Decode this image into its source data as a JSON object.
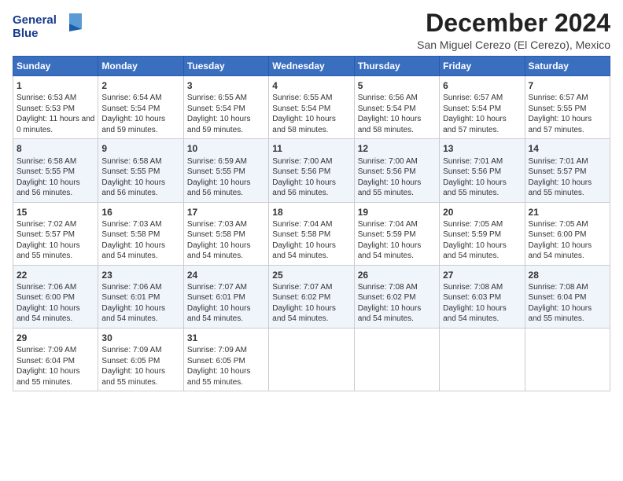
{
  "logo": {
    "line1": "General",
    "line2": "Blue"
  },
  "title": "December 2024",
  "subtitle": "San Miguel Cerezo (El Cerezo), Mexico",
  "days_header": [
    "Sunday",
    "Monday",
    "Tuesday",
    "Wednesday",
    "Thursday",
    "Friday",
    "Saturday"
  ],
  "weeks": [
    [
      {
        "day": "1",
        "sunrise": "6:53 AM",
        "sunset": "5:53 PM",
        "daylight": "11 hours and 0 minutes."
      },
      {
        "day": "2",
        "sunrise": "6:54 AM",
        "sunset": "5:54 PM",
        "daylight": "10 hours and 59 minutes."
      },
      {
        "day": "3",
        "sunrise": "6:55 AM",
        "sunset": "5:54 PM",
        "daylight": "10 hours and 59 minutes."
      },
      {
        "day": "4",
        "sunrise": "6:55 AM",
        "sunset": "5:54 PM",
        "daylight": "10 hours and 58 minutes."
      },
      {
        "day": "5",
        "sunrise": "6:56 AM",
        "sunset": "5:54 PM",
        "daylight": "10 hours and 58 minutes."
      },
      {
        "day": "6",
        "sunrise": "6:57 AM",
        "sunset": "5:54 PM",
        "daylight": "10 hours and 57 minutes."
      },
      {
        "day": "7",
        "sunrise": "6:57 AM",
        "sunset": "5:55 PM",
        "daylight": "10 hours and 57 minutes."
      }
    ],
    [
      {
        "day": "8",
        "sunrise": "6:58 AM",
        "sunset": "5:55 PM",
        "daylight": "10 hours and 56 minutes."
      },
      {
        "day": "9",
        "sunrise": "6:58 AM",
        "sunset": "5:55 PM",
        "daylight": "10 hours and 56 minutes."
      },
      {
        "day": "10",
        "sunrise": "6:59 AM",
        "sunset": "5:55 PM",
        "daylight": "10 hours and 56 minutes."
      },
      {
        "day": "11",
        "sunrise": "7:00 AM",
        "sunset": "5:56 PM",
        "daylight": "10 hours and 56 minutes."
      },
      {
        "day": "12",
        "sunrise": "7:00 AM",
        "sunset": "5:56 PM",
        "daylight": "10 hours and 55 minutes."
      },
      {
        "day": "13",
        "sunrise": "7:01 AM",
        "sunset": "5:56 PM",
        "daylight": "10 hours and 55 minutes."
      },
      {
        "day": "14",
        "sunrise": "7:01 AM",
        "sunset": "5:57 PM",
        "daylight": "10 hours and 55 minutes."
      }
    ],
    [
      {
        "day": "15",
        "sunrise": "7:02 AM",
        "sunset": "5:57 PM",
        "daylight": "10 hours and 55 minutes."
      },
      {
        "day": "16",
        "sunrise": "7:03 AM",
        "sunset": "5:58 PM",
        "daylight": "10 hours and 54 minutes."
      },
      {
        "day": "17",
        "sunrise": "7:03 AM",
        "sunset": "5:58 PM",
        "daylight": "10 hours and 54 minutes."
      },
      {
        "day": "18",
        "sunrise": "7:04 AM",
        "sunset": "5:58 PM",
        "daylight": "10 hours and 54 minutes."
      },
      {
        "day": "19",
        "sunrise": "7:04 AM",
        "sunset": "5:59 PM",
        "daylight": "10 hours and 54 minutes."
      },
      {
        "day": "20",
        "sunrise": "7:05 AM",
        "sunset": "5:59 PM",
        "daylight": "10 hours and 54 minutes."
      },
      {
        "day": "21",
        "sunrise": "7:05 AM",
        "sunset": "6:00 PM",
        "daylight": "10 hours and 54 minutes."
      }
    ],
    [
      {
        "day": "22",
        "sunrise": "7:06 AM",
        "sunset": "6:00 PM",
        "daylight": "10 hours and 54 minutes."
      },
      {
        "day": "23",
        "sunrise": "7:06 AM",
        "sunset": "6:01 PM",
        "daylight": "10 hours and 54 minutes."
      },
      {
        "day": "24",
        "sunrise": "7:07 AM",
        "sunset": "6:01 PM",
        "daylight": "10 hours and 54 minutes."
      },
      {
        "day": "25",
        "sunrise": "7:07 AM",
        "sunset": "6:02 PM",
        "daylight": "10 hours and 54 minutes."
      },
      {
        "day": "26",
        "sunrise": "7:08 AM",
        "sunset": "6:02 PM",
        "daylight": "10 hours and 54 minutes."
      },
      {
        "day": "27",
        "sunrise": "7:08 AM",
        "sunset": "6:03 PM",
        "daylight": "10 hours and 54 minutes."
      },
      {
        "day": "28",
        "sunrise": "7:08 AM",
        "sunset": "6:04 PM",
        "daylight": "10 hours and 55 minutes."
      }
    ],
    [
      {
        "day": "29",
        "sunrise": "7:09 AM",
        "sunset": "6:04 PM",
        "daylight": "10 hours and 55 minutes."
      },
      {
        "day": "30",
        "sunrise": "7:09 AM",
        "sunset": "6:05 PM",
        "daylight": "10 hours and 55 minutes."
      },
      {
        "day": "31",
        "sunrise": "7:09 AM",
        "sunset": "6:05 PM",
        "daylight": "10 hours and 55 minutes."
      },
      null,
      null,
      null,
      null
    ]
  ]
}
